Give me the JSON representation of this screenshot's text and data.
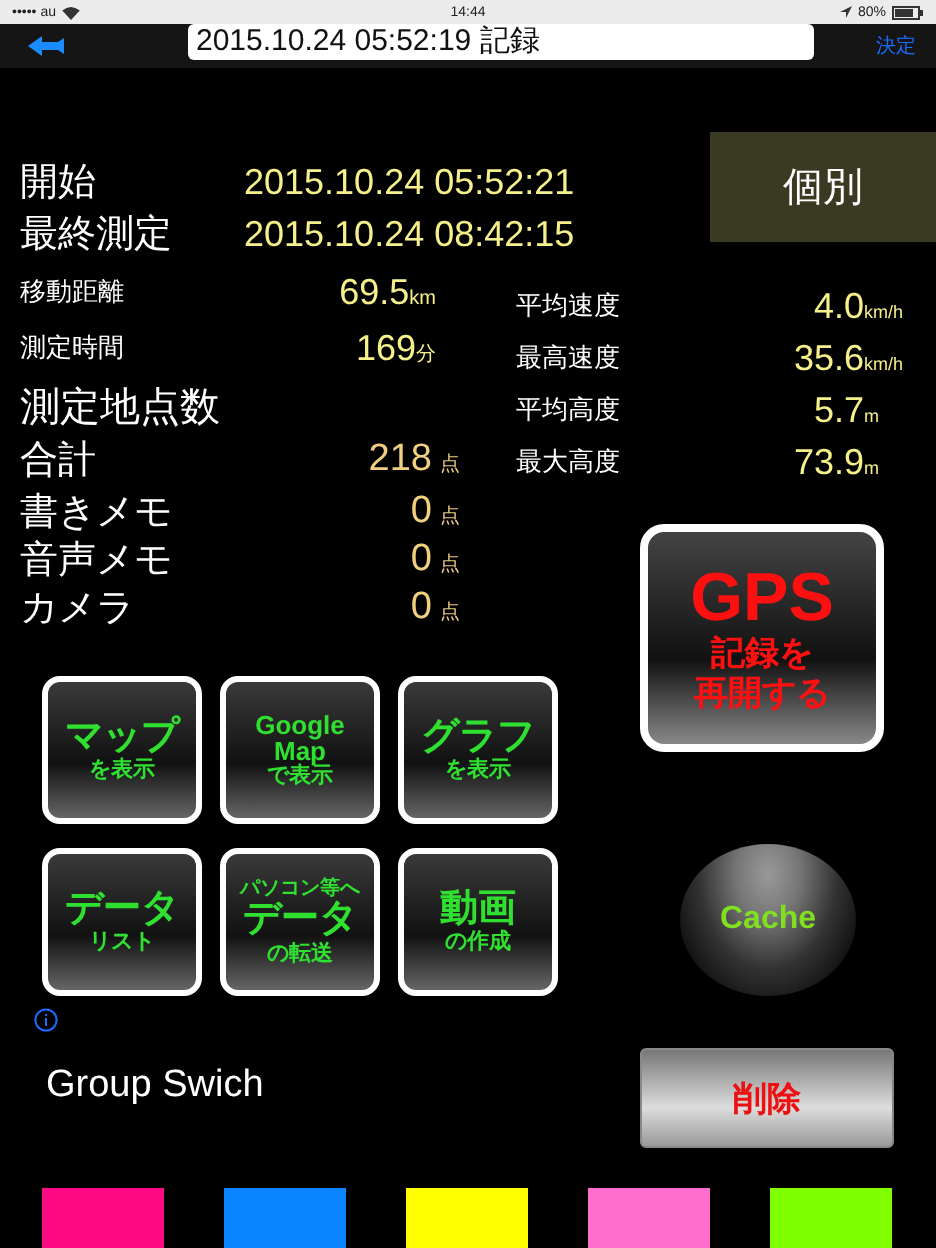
{
  "status_bar": {
    "carrier": "••••• au",
    "time": "14:44",
    "battery": "80%"
  },
  "nav_bar": {
    "title": "2015.10.24 05:52:19 記録",
    "done": "決定"
  },
  "times": [
    {
      "label": "開始",
      "value": "2015.10.24 05:52:21"
    },
    {
      "label": "最終測定",
      "value": "2015.10.24 08:42:15"
    }
  ],
  "individual_button": "個別",
  "left_stats": [
    {
      "label": "移動距離",
      "value": "69.5",
      "unit": "km",
      "kind": "small"
    },
    {
      "label": "測定時間",
      "value": "169",
      "unit": "分",
      "kind": "small"
    },
    {
      "label": "測定地点数",
      "kind": "heading"
    },
    {
      "label": "合計",
      "value": "218",
      "unit": "点",
      "kind": "count"
    }
  ],
  "right_stats": [
    {
      "label": "平均速度",
      "value": "4.0",
      "unit": "km/h"
    },
    {
      "label": "最高速度",
      "value": "35.6",
      "unit": "km/h"
    },
    {
      "label": "平均高度",
      "value": "5.7",
      "unit": "m"
    },
    {
      "label": "最大高度",
      "value": "73.9",
      "unit": "m"
    }
  ],
  "memo_stats": [
    {
      "label": "書きメモ",
      "value": "0",
      "unit": "点"
    },
    {
      "label": "音声メモ",
      "value": "0",
      "unit": "点"
    },
    {
      "label": "カメラ",
      "value": "0",
      "unit": "点"
    }
  ],
  "tiles": [
    {
      "lines": [
        {
          "text": "マップ",
          "kind": "main"
        },
        {
          "text": "を表示",
          "kind": "sub"
        }
      ]
    },
    {
      "lines": [
        {
          "text": "Google",
          "kind": "latin"
        },
        {
          "text": "Map",
          "kind": "latin"
        },
        {
          "text": "で表示",
          "kind": "sub"
        }
      ]
    },
    {
      "lines": [
        {
          "text": "グラフ",
          "kind": "main"
        },
        {
          "text": "を表示",
          "kind": "sub"
        }
      ]
    },
    {
      "lines": [
        {
          "text": "データ",
          "kind": "main"
        },
        {
          "text": "リスト",
          "kind": "sub"
        }
      ]
    },
    {
      "lines": [
        {
          "text": "パソコン等へ",
          "kind": "tiny"
        },
        {
          "text": "データ",
          "kind": "main"
        },
        {
          "text": "の転送",
          "kind": "sub"
        }
      ]
    },
    {
      "lines": [
        {
          "text": "動画",
          "kind": "main"
        },
        {
          "text": "の作成",
          "kind": "sub"
        }
      ]
    }
  ],
  "gps_button": {
    "title": "GPS",
    "lines": [
      "記録を",
      "再開する"
    ]
  },
  "cache_button": "Cache",
  "group_switch": "Group Swich",
  "delete_button": "削除",
  "color_swatches": [
    {
      "color": "#ff0a84"
    },
    {
      "color": "#0a84ff"
    },
    {
      "color": "#ffff00"
    },
    {
      "color": "#ff6ecc"
    },
    {
      "color": "#80ff00"
    }
  ]
}
